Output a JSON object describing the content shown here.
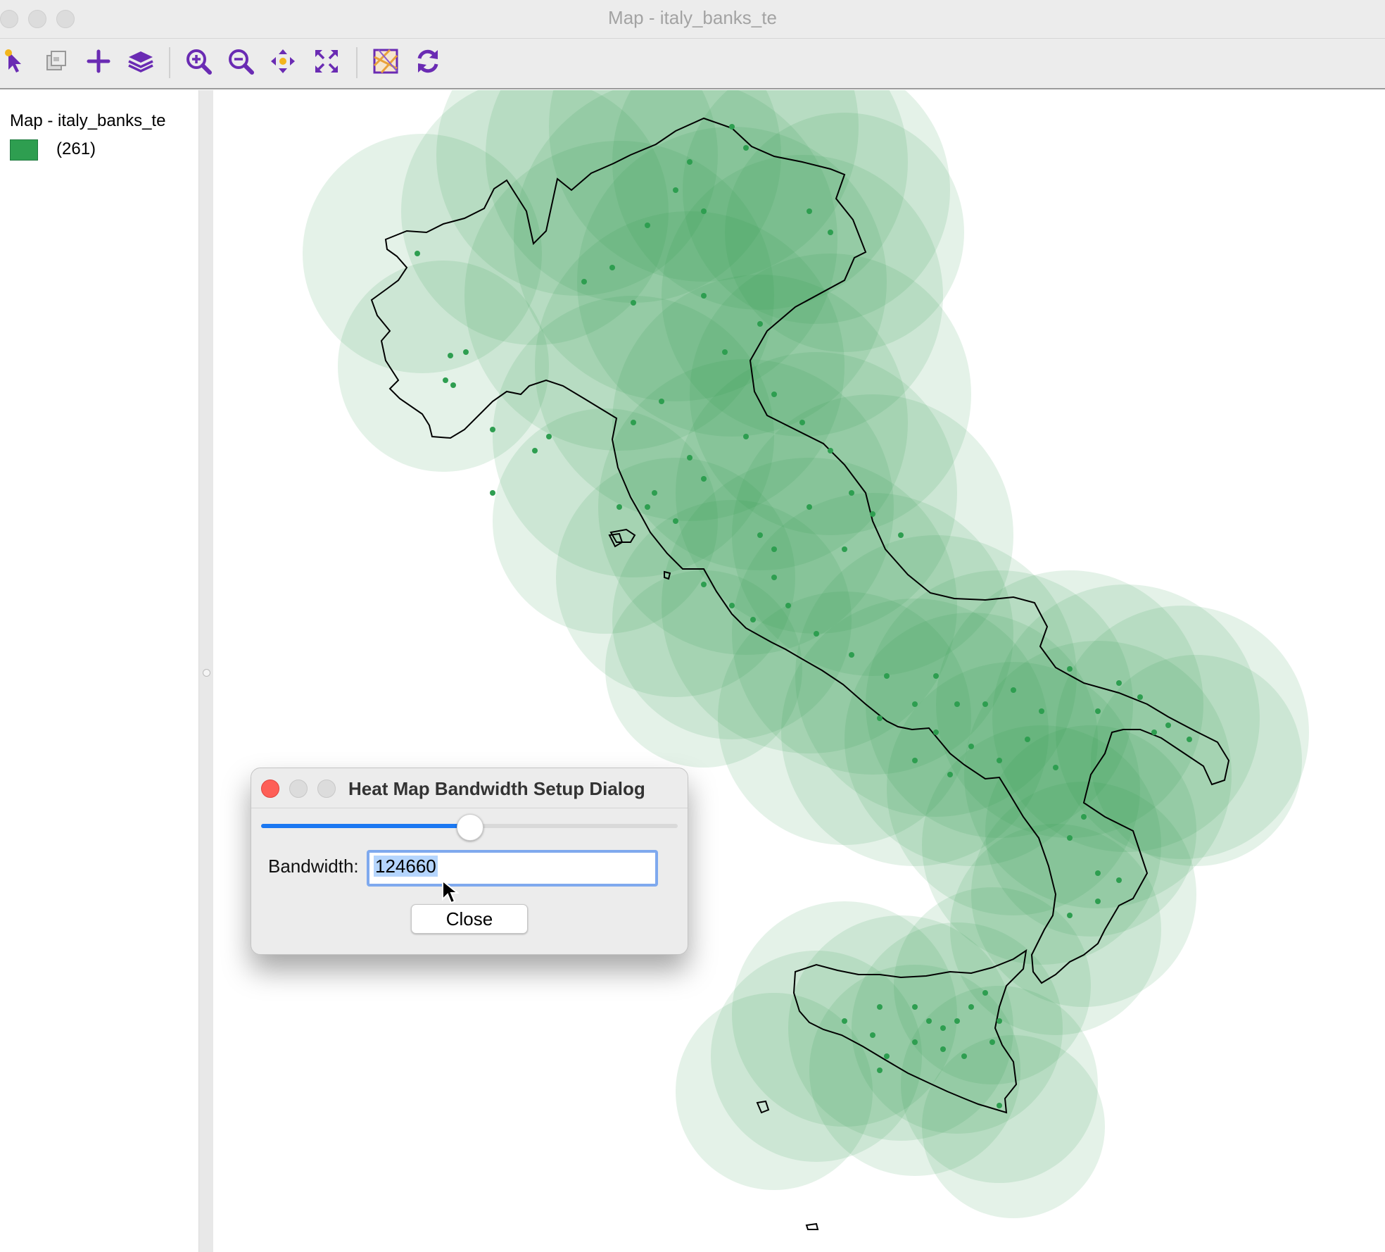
{
  "window": {
    "title": "Map - italy_banks_te"
  },
  "toolbar": {
    "buttons": [
      {
        "icon": "select-pointer-icon"
      },
      {
        "icon": "copy-image-icon"
      },
      {
        "icon": "add-layer-icon"
      },
      {
        "icon": "layers-icon"
      },
      {
        "icon": "zoom-in-icon"
      },
      {
        "icon": "zoom-out-icon"
      },
      {
        "icon": "pan-icon"
      },
      {
        "icon": "full-extent-icon"
      },
      {
        "icon": "basemap-icon"
      },
      {
        "icon": "refresh-icon"
      }
    ],
    "icon_color": "#6a2bb3"
  },
  "legend": {
    "title": "Map - italy_banks_te",
    "items": [
      {
        "count_label": "(261)",
        "color": "#2e9e50"
      }
    ]
  },
  "map": {
    "heat_color": "#2e9e50",
    "point_color": "#2e9e50",
    "outline_color": "#000000"
  },
  "dialog": {
    "title": "Heat Map Bandwidth Setup Dialog",
    "slider_fraction": 0.5,
    "bandwidth_label": "Bandwidth:",
    "bandwidth_value": "124660",
    "close_label": "Close"
  }
}
